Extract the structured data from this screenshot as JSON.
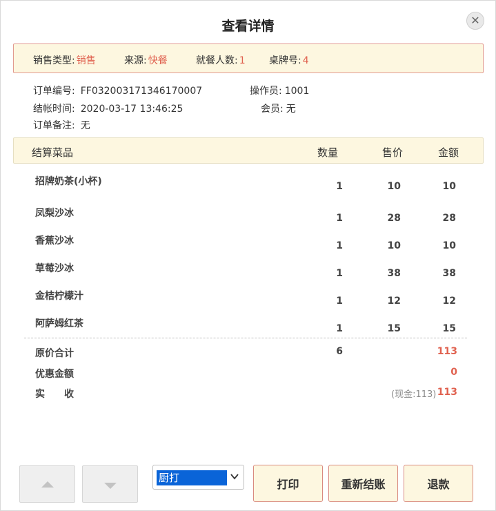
{
  "dialog": {
    "title": "查看详情",
    "close_symbol": "✕"
  },
  "banner": {
    "sale_type_label": "销售类型:",
    "sale_type_value": "销售",
    "source_label": "来源:",
    "source_value": "快餐",
    "diners_label": "就餐人数:",
    "diners_value": "1",
    "table_label": "桌牌号:",
    "table_value": "4"
  },
  "order": {
    "order_no_label": "订单编号:",
    "order_no": "FF032003171346170007",
    "operator_label": "操作员:",
    "operator": "1001",
    "checkout_time_label": "结帐时间:",
    "checkout_time": "2020-03-17 13:46:25",
    "member_label": "会员:",
    "member": "无",
    "remark_label": "订单备注:",
    "remark": "无"
  },
  "table": {
    "headers": {
      "dish": "结算菜品",
      "qty": "数量",
      "price": "售价",
      "amount": "金额"
    },
    "rows": [
      {
        "name": "招牌奶茶(小杯)",
        "qty": "1",
        "price": "10",
        "amount": "10"
      },
      {
        "name": "凤梨沙冰",
        "qty": "1",
        "price": "28",
        "amount": "28"
      },
      {
        "name": "香蕉沙冰",
        "qty": "1",
        "price": "10",
        "amount": "10"
      },
      {
        "name": "草莓沙冰",
        "qty": "1",
        "price": "38",
        "amount": "38"
      },
      {
        "name": "金桔柠檬汁",
        "qty": "1",
        "price": "12",
        "amount": "12"
      },
      {
        "name": "阿萨姆红茶",
        "qty": "1",
        "price": "15",
        "amount": "15"
      }
    ]
  },
  "summary": {
    "original_total_label": "原价合计",
    "original_total_qty": "6",
    "original_total_amount": "113",
    "discount_label": "优惠金额",
    "discount_amount": "0",
    "received_label": "实　　收",
    "received_note": "(现金:113)",
    "received_amount": "113"
  },
  "footer": {
    "print_mode": "厨打",
    "print_button": "打印",
    "recheckout_button": "重新结账",
    "refund_button": "退款"
  },
  "colors": {
    "accent_red": "#e0614f",
    "banner_bg": "#fdf7e0",
    "select_highlight": "#0a64d8"
  }
}
